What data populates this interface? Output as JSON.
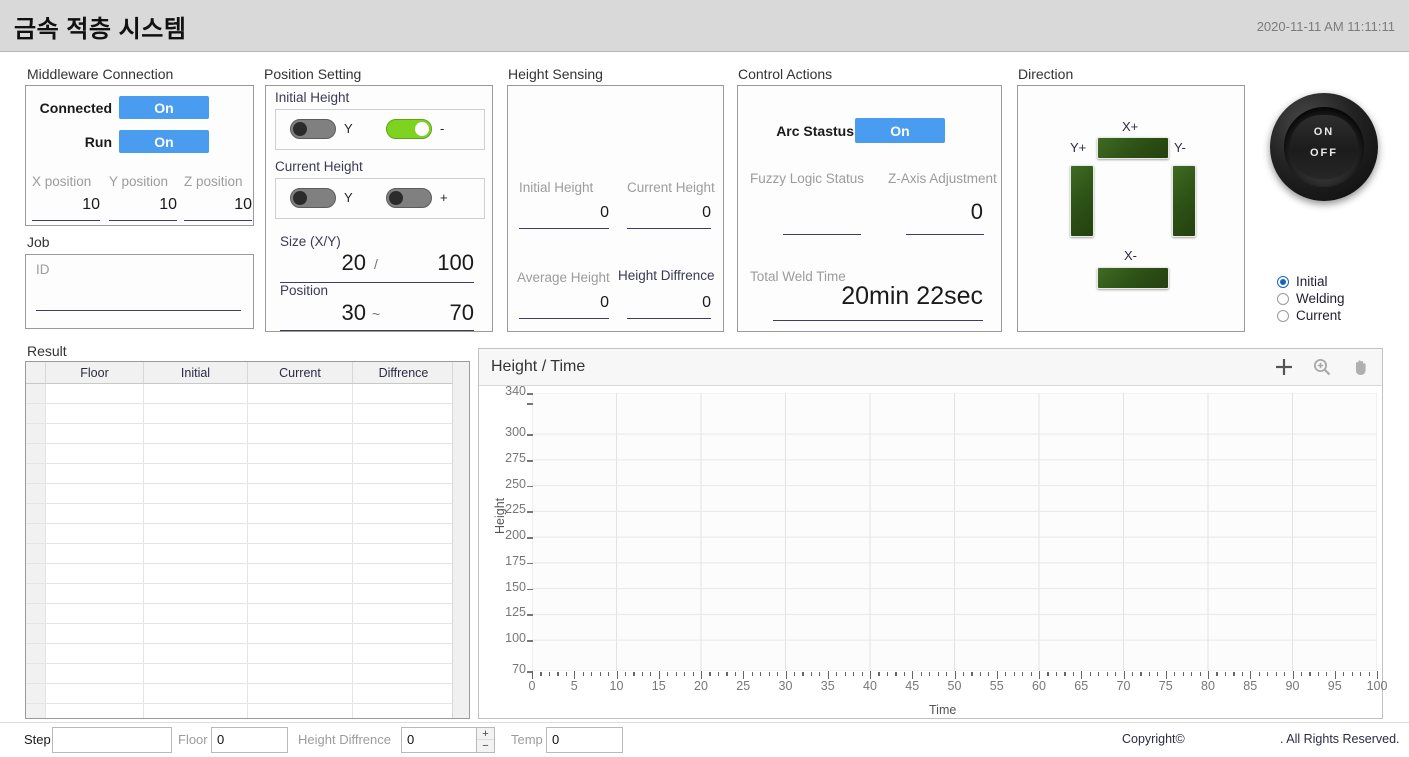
{
  "app": {
    "title": "금속 적층 시스템",
    "timestamp": "2020-11-11 AM 11:11:11"
  },
  "middleware": {
    "group_label": "Middleware Connection",
    "connected_label": "Connected",
    "connected_state": "On",
    "run_label": "Run",
    "run_state": "On",
    "x_position_label": "X position",
    "x_position_value": "10",
    "y_position_label": "Y position",
    "y_position_value": "10",
    "z_position_label": "Z position",
    "z_position_value": "10"
  },
  "job": {
    "group_label": "Job",
    "id_label": "ID",
    "id_value": ""
  },
  "position_setting": {
    "group_label": "Position Setting",
    "initial_height_label": "Initial Height",
    "initial_toggle_left_label": "Y",
    "initial_toggle_left_state": "off",
    "initial_toggle_right_label": "-",
    "initial_toggle_right_state": "on",
    "current_height_label": "Current Height",
    "current_toggle_left_label": "Y",
    "current_toggle_left_state": "off",
    "current_toggle_right_label": "+",
    "current_toggle_right_state": "off",
    "size_label": "Size (X/Y)",
    "size_x": "20",
    "size_separator": "/",
    "size_y": "100",
    "position_label": "Position",
    "position_from": "30",
    "position_separator": "~",
    "position_to": "70"
  },
  "height_sensing": {
    "group_label": "Height Sensing",
    "initial_height_label": "Initial Height",
    "initial_height_value": "0",
    "current_height_label": "Current Height",
    "current_height_value": "0",
    "average_height_label": "Average Height",
    "average_height_value": "0",
    "height_diffrence_label": "Height Diffrence",
    "height_diffrence_value": "0"
  },
  "control_actions": {
    "group_label": "Control Actions",
    "arc_status_label": "Arc Stastus",
    "arc_status_state": "On",
    "fuzzy_logic_label": "Fuzzy Logic Status",
    "fuzzy_logic_value": "",
    "z_axis_label": "Z-Axis Adjustment",
    "z_axis_value": "0",
    "total_weld_time_label": "Total Weld Time",
    "total_weld_time_value": "20min 22sec"
  },
  "direction": {
    "group_label": "Direction",
    "x_plus_label": "X+",
    "y_plus_label": "Y+",
    "y_minus_label": "Y-",
    "x_minus_label": "X-"
  },
  "power": {
    "on_label": "ON",
    "off_label": "OFF",
    "modes": [
      {
        "label": "Initial",
        "selected": true
      },
      {
        "label": "Welding",
        "selected": false
      },
      {
        "label": "Current",
        "selected": false
      }
    ]
  },
  "result": {
    "group_label": "Result",
    "columns": [
      "Floor",
      "Initial",
      "Current",
      "Diffrence"
    ],
    "rows": [],
    "empty_row_count": 17
  },
  "chart_data": {
    "type": "line",
    "title": "Height / Time",
    "xlabel": "Time",
    "ylabel": "Height",
    "xlim": [
      0,
      100
    ],
    "ylim": [
      70,
      340
    ],
    "grid": true,
    "legend": null,
    "xticks": [
      0,
      5,
      10,
      15,
      20,
      25,
      30,
      35,
      40,
      45,
      50,
      55,
      60,
      65,
      70,
      75,
      80,
      85,
      90,
      95,
      100
    ],
    "yticks": [
      340,
      300,
      275,
      250,
      225,
      200,
      175,
      150,
      125,
      100,
      70
    ],
    "series": [],
    "x": [],
    "values": []
  },
  "chart_tools": [
    {
      "icon": "crosshair-icon",
      "active": true
    },
    {
      "icon": "zoom-in-icon",
      "active": false
    },
    {
      "icon": "pan-hand-icon",
      "active": false
    }
  ],
  "bottom_bar": {
    "step_label": "Step",
    "step_value": "",
    "floor_label": "Floor",
    "floor_value": "0",
    "height_diffrence_label": "Height Diffrence",
    "height_diffrence_value": "0",
    "spinner_up": "+",
    "spinner_down": "−",
    "temp_label": "Temp",
    "temp_value": "0",
    "copyright_left": "Copyright©",
    "copyright_right": ". All Rights Reserved."
  },
  "colors": {
    "accent_blue": "#4a9cf0",
    "led_green": "#2f5417",
    "toggle_on_green": "#7ed321",
    "titlebar": "#d9d9d9",
    "radio_selected": "#1565c0"
  }
}
